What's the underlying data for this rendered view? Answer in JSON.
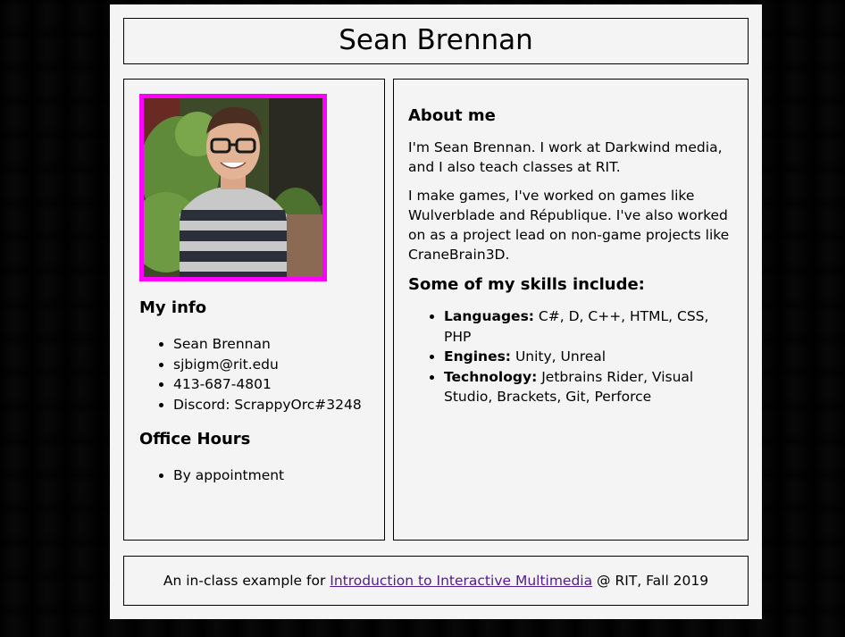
{
  "header": {
    "title": "Sean Brennan"
  },
  "left": {
    "my_info_heading": "My info",
    "my_info_items": [
      "Sean Brennan",
      "sjbigm@rit.edu",
      "413-687-4801",
      "Discord: ScrappyOrc#3248"
    ],
    "office_hours_heading": "Office Hours",
    "office_hours_items": [
      "By appointment"
    ]
  },
  "right": {
    "about_heading": "About me",
    "about_p1": "I'm Sean Brennan. I work at Darkwind media, and I also teach classes at RIT.",
    "about_p2": "I make games, I've worked on games like Wulverblade and République. I've also worked on as a project lead on non-game projects like CraneBrain3D.",
    "skills_heading": "Some of my skills include:",
    "skills": [
      {
        "label": "Languages:",
        "value": " C#, D, C++, HTML, CSS, PHP"
      },
      {
        "label": "Engines:",
        "value": " Unity, Unreal"
      },
      {
        "label": "Technology:",
        "value": " Jetbrains Rider, Visual Studio, Brackets, Git, Perforce"
      }
    ]
  },
  "footer": {
    "prefix": "An in-class example for ",
    "link_text": "Introduction to Interactive Multimedia",
    "suffix": " @ RIT, Fall 2019"
  },
  "colors": {
    "photo_border": "#ff00ff",
    "link": "#551a8b",
    "page_bg": "#f4f4f4"
  }
}
